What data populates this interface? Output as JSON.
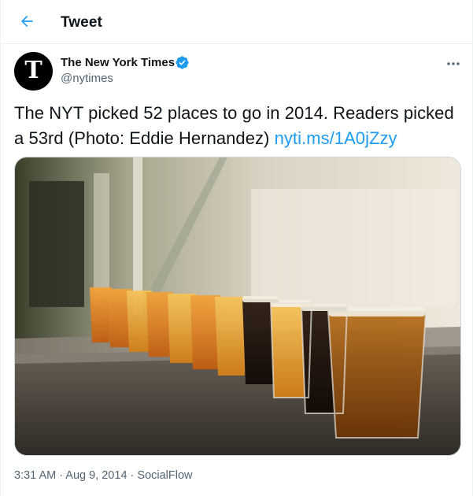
{
  "header": {
    "title": "Tweet",
    "back_icon": "arrow-left-icon",
    "accent": "#1d9bf0"
  },
  "tweet": {
    "author_name": "The New York Times",
    "handle": "@nytimes",
    "avatar_letter": "T",
    "verified": true,
    "text": "The NYT picked 52 places to go in 2014. Readers picked a 53rd (Photo: Eddie Hernandez) ",
    "link_text": "nyti.ms/1A0jZzy",
    "time": "3:31 AM",
    "separator": " · ",
    "date": "Aug 9, 2014",
    "source": "SocialFlow"
  },
  "colors": {
    "link": "#1d9bf0",
    "secondary_text": "#536471",
    "border": "#eff3f4"
  }
}
